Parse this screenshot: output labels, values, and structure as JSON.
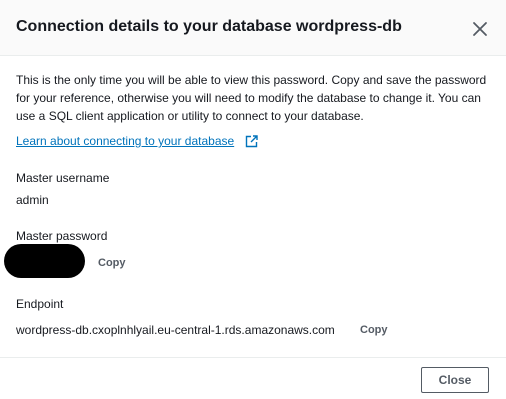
{
  "dialog": {
    "title": "Connection details to your database wordpress-db",
    "intro": "This is the only time you will be able to view this password. Copy and save the password for your reference, otherwise you will need to modify the database to change it. You can use a SQL client application or utility to connect to your database.",
    "learn_link": "Learn about connecting to your database"
  },
  "fields": {
    "username_label": "Master username",
    "username_value": "admin",
    "password_label": "Master password",
    "password_copy": "Copy",
    "endpoint_label": "Endpoint",
    "endpoint_value": "wordpress-db.cxoplnhlyail.eu-central-1.rds.amazonaws.com",
    "endpoint_copy": "Copy"
  },
  "footer": {
    "close_label": "Close"
  },
  "icons": {
    "close": "close-icon",
    "external_link": "external-link-icon"
  },
  "colors": {
    "link": "#0073bb",
    "text": "#16191f",
    "secondary": "#545b64"
  }
}
